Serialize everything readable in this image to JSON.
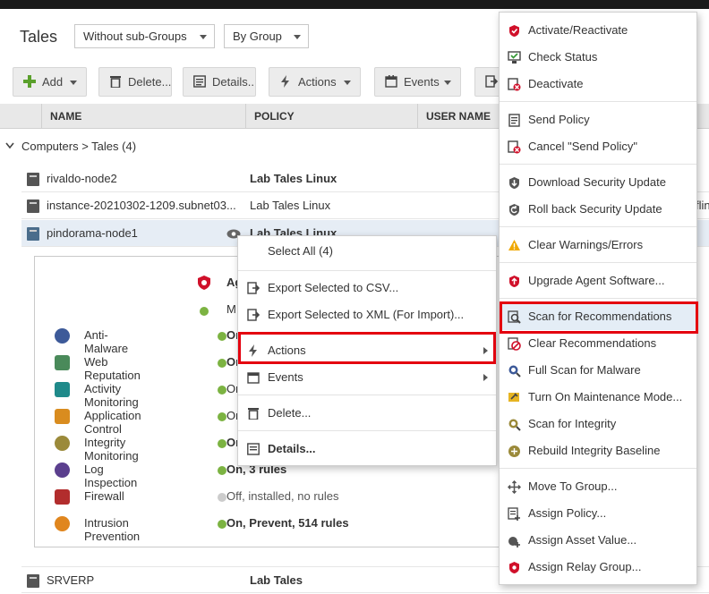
{
  "page": {
    "title": "Tales",
    "filter1": "Without sub-Groups",
    "filter2": "By Group"
  },
  "toolbar": {
    "add": "Add",
    "delete": "Delete...",
    "details": "Details...",
    "actions": "Actions",
    "events": "Events"
  },
  "table": {
    "columns": [
      "NAME",
      "POLICY",
      "USER NAME"
    ],
    "group_label": "Computers > Tales",
    "group_count": "(4)",
    "rows": [
      {
        "name": "rivaldo-node2",
        "policy": "Lab Tales Linux"
      },
      {
        "name": "instance-20210302-1209.subnet03...",
        "policy": "Lab Tales Linux"
      },
      {
        "name": "pindorama-node1",
        "policy": "Lab Tales Linux"
      },
      {
        "name": "SRVERP",
        "policy": "Lab Tales"
      }
    ],
    "edge_text": "flin"
  },
  "detail": {
    "header1_text": "Ag",
    "header2_text": "M",
    "modules": [
      {
        "name": "Anti-Malware",
        "status": "On",
        "color": "#3d5a99"
      },
      {
        "name": "Web Reputation",
        "status": "On",
        "color": "#4a8a5a"
      },
      {
        "name": "Activity Monitoring",
        "status": "On",
        "color": "#1f8a8a"
      },
      {
        "name": "Application Control",
        "status": "On",
        "color": "#d98c1f"
      },
      {
        "name": "Integrity Monitoring",
        "status": "On",
        "color": "#9b8a3a"
      },
      {
        "name": "Log Inspection",
        "status": "On, 3 rules",
        "color": "#5b3f8e"
      },
      {
        "name": "Firewall",
        "status": "Off, installed, no rules",
        "color": "#b22d2d"
      },
      {
        "name": "Intrusion Prevention",
        "status": "On, Prevent, 514 rules",
        "color": "#e0861e"
      }
    ]
  },
  "context_menu": {
    "select_all": "Select All (4)",
    "export_csv": "Export Selected to CSV...",
    "export_xml": "Export Selected to XML (For Import)...",
    "actions": "Actions",
    "events": "Events",
    "delete": "Delete...",
    "details": "Details..."
  },
  "submenu": [
    {
      "label": "Activate/Reactivate",
      "icon": "activate-icon"
    },
    {
      "label": "Check Status",
      "icon": "check-status-icon"
    },
    {
      "label": "Deactivate",
      "icon": "deactivate-icon"
    },
    {
      "label": "Send Policy",
      "icon": "send-policy-icon"
    },
    {
      "label": "Cancel \"Send Policy\"",
      "icon": "cancel-send-icon"
    },
    {
      "label": "Download Security Update",
      "icon": "download-update-icon"
    },
    {
      "label": "Roll back Security Update",
      "icon": "rollback-icon"
    },
    {
      "label": "Clear Warnings/Errors",
      "icon": "warning-icon"
    },
    {
      "label": "Upgrade Agent Software...",
      "icon": "upgrade-icon"
    },
    {
      "label": "Scan for Recommendations",
      "icon": "scan-recommendations-icon"
    },
    {
      "label": "Clear Recommendations",
      "icon": "clear-recommendations-icon"
    },
    {
      "label": "Full Scan for Malware",
      "icon": "malware-scan-icon"
    },
    {
      "label": "Turn On Maintenance Mode...",
      "icon": "maintenance-icon"
    },
    {
      "label": "Scan for Integrity",
      "icon": "integrity-scan-icon"
    },
    {
      "label": "Rebuild Integrity Baseline",
      "icon": "rebuild-baseline-icon"
    },
    {
      "label": "Move To Group...",
      "icon": "move-icon"
    },
    {
      "label": "Assign Policy...",
      "icon": "assign-policy-icon"
    },
    {
      "label": "Assign Asset Value...",
      "icon": "asset-value-icon"
    },
    {
      "label": "Assign Relay Group...",
      "icon": "relay-group-icon"
    }
  ],
  "colors": {
    "highlight": "#e4000f",
    "status_on": "#7cb342",
    "status_off": "#cccccc",
    "row_selected": "#e6edf5"
  }
}
